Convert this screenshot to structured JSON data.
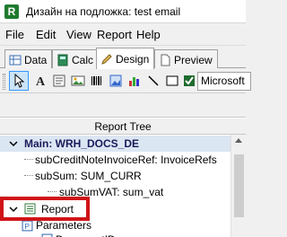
{
  "window": {
    "title": "Дизайн на подложка: test email",
    "app_icon_letter": "R"
  },
  "menu": {
    "items": [
      "File",
      "Edit",
      "View",
      "Report",
      "Help"
    ]
  },
  "tabs": {
    "items": [
      "Data",
      "Calc",
      "Design",
      "Preview"
    ],
    "active": "Design"
  },
  "toolbar": {
    "tools": [
      "pointer-tool",
      "text-tool",
      "rich-text-tool",
      "image-tool",
      "barcode-tool",
      "picture-tool",
      "chart-tool",
      "line-tool",
      "shape-tool",
      "checkbox-tool"
    ],
    "font_name": "Microsoft"
  },
  "report_tree": {
    "header": "Report Tree",
    "nodes": {
      "main": "Main: WRH_DOCS_DE",
      "sub_credit": "subCreditNoteInvoiceRef: InvoiceRefs",
      "sub_sum": "subSum: SUM_CURR",
      "sub_sum_vat": "subSumVAT: sum_vat",
      "report": "Report",
      "parameters": "Parameters",
      "document_id": "DocumentID"
    }
  },
  "colors": {
    "highlight_box": "#d01418",
    "selection": "#dbe6f3",
    "accent": "#3399ff"
  }
}
